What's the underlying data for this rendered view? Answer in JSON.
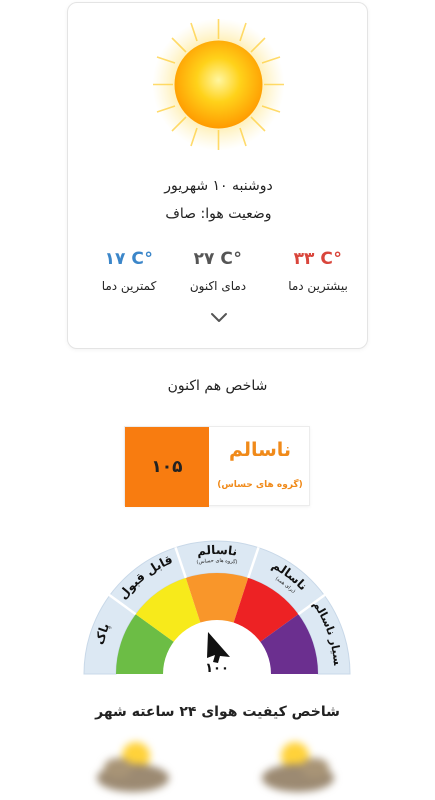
{
  "weather_card": {
    "date": "دوشنبه ۱۰ شهریور",
    "condition": "وضعیت هوا: صاف",
    "weather_icon": "sun-icon",
    "temps": [
      {
        "key": "max",
        "value": "۳۳ C°",
        "label": "بیشترین دما",
        "color": "#d9453b"
      },
      {
        "key": "current",
        "value": "۲۷ C°",
        "label": "دمای اکنون",
        "color": "#555555"
      },
      {
        "key": "min",
        "value": "۱۷ C°",
        "label": "کمترین دما",
        "color": "#3b86c9"
      }
    ],
    "expand_icon": "chevron-down-icon"
  },
  "aqi": {
    "section_title": "شاخص هم اکنون",
    "value": "۱۰۵",
    "status": "ناسالم",
    "sub_status": "(گروه های حساس)",
    "value_bg_color": "#f87c10",
    "status_color": "#f08a1a"
  },
  "gauge": {
    "segments": [
      {
        "label": "پاک",
        "color": "#6cbd45"
      },
      {
        "label": "قابل قبول",
        "color": "#f7ea1b"
      },
      {
        "label": "ناسالم",
        "sub": "(گروه های حساس)",
        "color": "#f9962a"
      },
      {
        "label": "ناسالم",
        "sub": "(برای همه)",
        "color": "#ed2224"
      },
      {
        "label": "بسیار ناسالم",
        "color": "#6b2f8f"
      }
    ],
    "needle_value": "۱۰۰"
  },
  "city": {
    "title": "شاخص کیفیت هوای ۲۴ ساعته شهر"
  }
}
